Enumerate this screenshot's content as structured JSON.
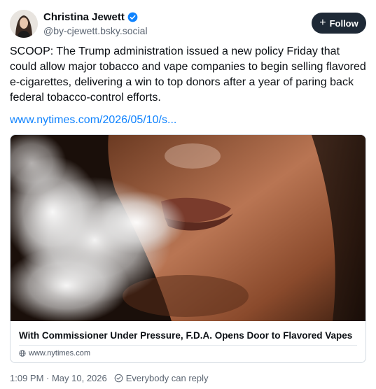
{
  "author": {
    "display_name": "Christina Jewett",
    "handle": "@by-cjewett.bsky.social",
    "verified_icon": "verified-check-icon"
  },
  "follow_button": {
    "label": "Follow",
    "icon": "plus"
  },
  "post": {
    "text": "SCOOP: The Trump administration issued a new policy Friday that could allow major tobacco and vape companies to begin selling flavored e-cigarettes, delivering a win to top donors after a year of paring back federal tobacco-control efforts.",
    "link_text": "www.nytimes.com/2026/05/10/s..."
  },
  "link_card": {
    "title": "With Commissioner Under Pressure, F.D.A. Opens Door to Flavored Vapes",
    "domain": "www.nytimes.com"
  },
  "footer": {
    "timestamp": "1:09 PM · May 10, 2026",
    "reply_setting": "Everybody can reply"
  },
  "colors": {
    "link": "#1083fe",
    "follow_bg": "#1e2936",
    "verified": "#1083fe",
    "muted": "#5b6572"
  }
}
